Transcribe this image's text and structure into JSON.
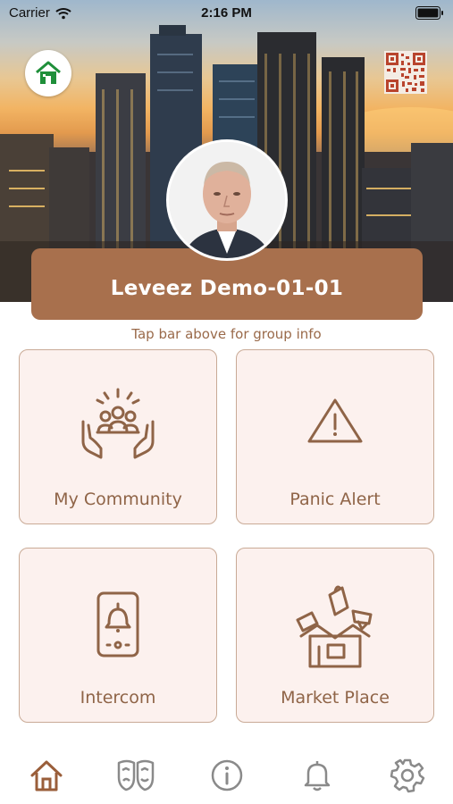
{
  "status_bar": {
    "carrier": "Carrier",
    "time": "2:16 PM"
  },
  "header": {
    "group_name": "Leveez Demo-01-01",
    "hint": "Tap bar above for group info"
  },
  "tiles": [
    {
      "label": "My Community",
      "icon": "community-hands-icon"
    },
    {
      "label": "Panic Alert",
      "icon": "warning-triangle-icon"
    },
    {
      "label": "Intercom",
      "icon": "intercom-bell-icon"
    },
    {
      "label": "Market Place",
      "icon": "marketplace-store-icon"
    }
  ],
  "tab_bar": {
    "items": [
      {
        "icon": "home-icon",
        "active": true
      },
      {
        "icon": "masks-icon",
        "active": false
      },
      {
        "icon": "info-icon",
        "active": false
      },
      {
        "icon": "bell-icon",
        "active": false
      },
      {
        "icon": "gear-icon",
        "active": false
      }
    ]
  },
  "colors": {
    "accent": "#a8704d",
    "tile_background": "#fcf1ee",
    "tile_border": "#c9aa96",
    "icon_brown": "#8f6447",
    "home_badge_green": "#1f8f3a",
    "tab_active": "#9a5e3a",
    "tab_inactive": "#8a8a8a"
  }
}
